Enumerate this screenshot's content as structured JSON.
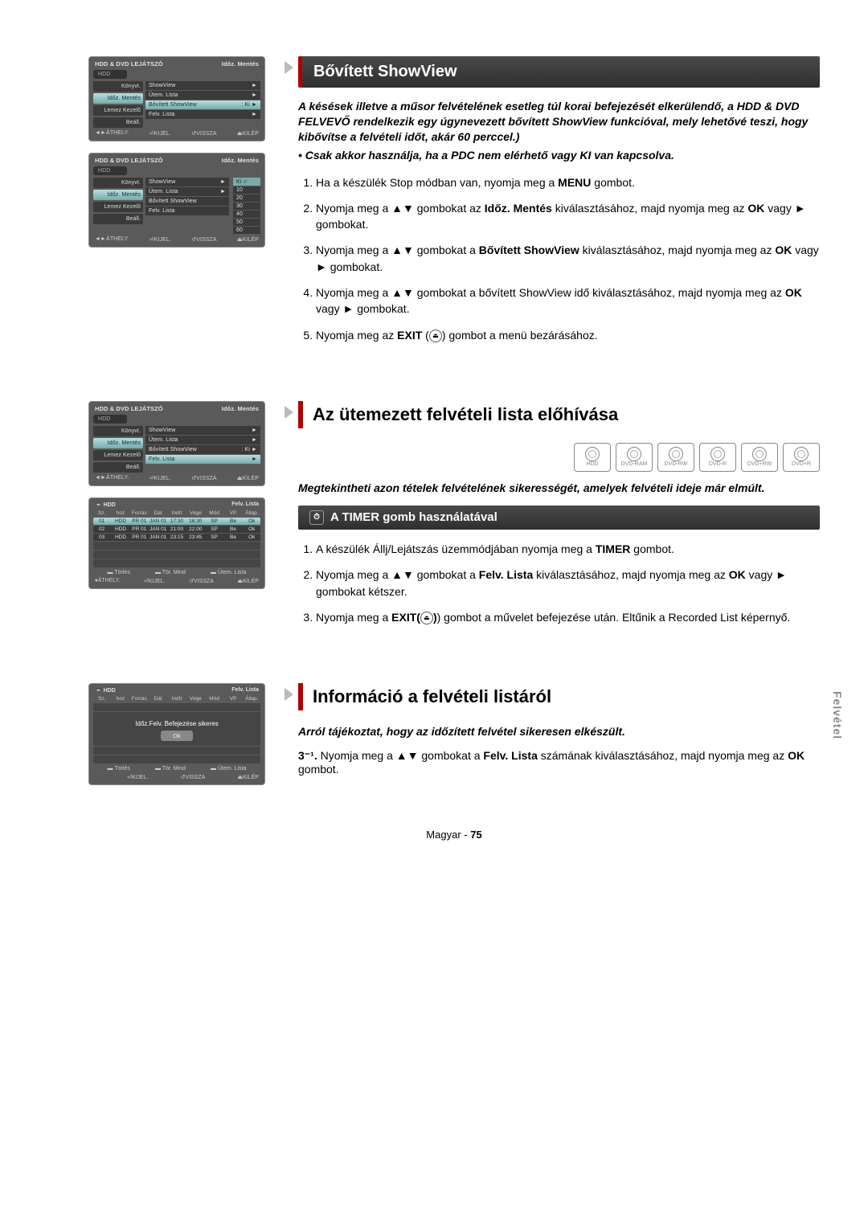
{
  "osdHeader": {
    "title": "HDD & DVD LEJÁTSZÓ",
    "mode": "Időz. Mentés",
    "hdd": "HDD"
  },
  "osdNav": [
    "Könyvt.",
    "Időz. Mentés",
    "Lemez Kezelő",
    "Beáll."
  ],
  "osdMenu1": [
    {
      "label": "ShowView",
      "right": "►"
    },
    {
      "label": "Ütem. Lista",
      "right": "►"
    },
    {
      "label": "Bővített ShowView",
      "right": ": Ki",
      "sel": true,
      "arrow": "►"
    },
    {
      "label": "Felv. Lista",
      "right": "►"
    }
  ],
  "osdMenu2": [
    {
      "label": "ShowView",
      "right": "►"
    },
    {
      "label": "Ütem. Lista",
      "right": "►"
    },
    {
      "label": "Bővített ShowView",
      "right": ""
    },
    {
      "label": "Felv. Lista",
      "right": ""
    }
  ],
  "osdDropdown": [
    {
      "label": "Ki",
      "sel": true
    },
    {
      "label": "10"
    },
    {
      "label": "20"
    },
    {
      "label": "30"
    },
    {
      "label": "40"
    },
    {
      "label": "50"
    },
    {
      "label": "60"
    }
  ],
  "osdFoot": {
    "move": "◄►ÁTHELY.",
    "sel": "⏎KIJEL.",
    "back": "↺VISSZA",
    "exit": "⏏KILÉP",
    "alt": "♦ÁTHELY."
  },
  "osdMenu3": [
    {
      "label": "ShowView",
      "right": "►"
    },
    {
      "label": "Ütem. Lista",
      "right": "►"
    },
    {
      "label": "Bővített ShowView",
      "right": ": Ki",
      "arrow": "►"
    },
    {
      "label": "Felv. Lista",
      "right": "",
      "sel": true,
      "arrow": "►"
    }
  ],
  "recTable": {
    "title": "HDD",
    "label": "Felv. Lista",
    "head": [
      "Sz.",
      "hoz",
      "Forrás",
      "Dát",
      "Indít",
      "Vége",
      "Mód",
      "VP",
      "Állap."
    ],
    "rows": [
      [
        "01",
        "HDD",
        "PR 01",
        "JAN 01",
        "17:30",
        "18:30",
        "SP",
        "Be",
        "Ok"
      ],
      [
        "02",
        "HDD",
        "PR 01",
        "JAN 01",
        "21:00",
        "22:00",
        "SP",
        "Be",
        "Ok"
      ],
      [
        "03",
        "HDD",
        "PR 01",
        "JAN 01",
        "23:15",
        "23:45",
        "SP",
        "Be",
        "Ok"
      ]
    ],
    "foot": [
      "▬ Törlés",
      "▬ Tör. Mind",
      "▬ Ütem. Lista"
    ]
  },
  "recTable2": {
    "msg": "Időz.Felv. Befejezése sikeres",
    "ok": "Ok"
  },
  "sec1": {
    "title": "Bővített ShowView",
    "intro": "A késések illetve a műsor felvételének esetleg túl korai befejezését elkerülendő, a HDD & DVD FELVEVŐ rendelkezik egy úgynevezett bővített ShowView funkcióval, mely lehetővé teszi, hogy kibővítse a felvételi időt, akár 60 perccel.)",
    "note": "• Csak akkor használja, ha a PDC nem elérhető vagy KI van kapcsolva.",
    "steps": [
      {
        "pre": "Ha a készülék Stop módban van, nyomja meg a ",
        "b": "MENU",
        "post": " gombot."
      },
      {
        "pre": "Nyomja meg a ▲▼ gombokat az ",
        "b": "Időz. Mentés",
        "post": " kiválasztásához, majd nyomja meg az ",
        "b2": "OK",
        "post2": " vagy ► gombokat."
      },
      {
        "pre": "Nyomja meg a ▲▼ gombokat a ",
        "b": "Bővített ShowView",
        "post": " kiválasztásához, majd nyomja meg az ",
        "b2": "OK",
        "post2": " vagy ► gombokat."
      },
      {
        "pre": "Nyomja meg a ▲▼ gombokat a bővített ShowView idő kiválasztásához, majd nyomja meg az ",
        "b": "OK",
        "post": " vagy ► gombokat."
      },
      {
        "pre": "Nyomja meg az ",
        "b": "EXIT",
        "post": " ( ) gombot a menü bezárásához."
      }
    ]
  },
  "sec2": {
    "title": "Az ütemezett felvételi lista előhívása",
    "mediaLabels": [
      "HDD",
      "DVD-RAM",
      "DVD-RW",
      "DVD-R",
      "DVD+RW",
      "DVD+R"
    ],
    "intro": "Megtekintheti azon tételek felvételének sikerességét, amelyek felvételi ideje már elmúlt.",
    "subhead": "A TIMER gomb használatával",
    "steps": [
      {
        "pre": "A készülék Állj/Lejátszás üzemmódjában nyomja meg a ",
        "b": "TIMER",
        "post": " gombot."
      },
      {
        "pre": "Nyomja meg a ▲▼ gombokat a ",
        "b": "Felv. Lista",
        "post": " kiválasztásához, majd nyomja meg az ",
        "b2": "OK",
        "post2": " vagy ► gombokat kétszer."
      },
      {
        "pre": "Nyomja meg a ",
        "b": "EXIT(",
        "post": ") gombot a művelet befejezése után. Eltűnik a Recorded List képernyő."
      }
    ]
  },
  "sec3": {
    "title": "Információ a felvételi listáról",
    "intro": "Arról tájékoztat, hogy az időzített felvétel sikeresen elkészült.",
    "step_prefix": "3⁻¹.",
    "step": {
      "pre": "Nyomja meg a ▲▼ gombokat a ",
      "b": "Felv. Lista",
      "post": " számának kiválasztásához, majd nyomja meg az ",
      "b2": "OK",
      "post2": " gombot."
    }
  },
  "sidetab": "Felvétel",
  "footer": {
    "lang": "Magyar",
    "sep": " - ",
    "pg": "75"
  }
}
